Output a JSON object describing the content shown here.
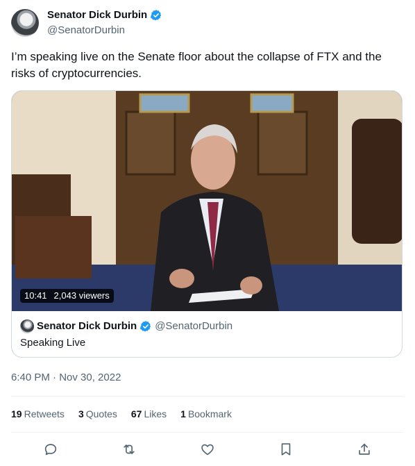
{
  "author": {
    "name": "Senator Dick Durbin",
    "handle": "@SenatorDurbin"
  },
  "tweet": {
    "text": "I’m speaking live on the Senate floor about the collapse of FTX and the risks of cryptocurrencies."
  },
  "video_card": {
    "duration": "10:41",
    "viewers": "2,043 viewers",
    "author_name": "Senator Dick Durbin",
    "author_handle": "@SenatorDurbin",
    "title": "Speaking Live"
  },
  "timestamp": "6:40 PM · Nov 30, 2022",
  "stats": [
    {
      "count": "19",
      "label": "Retweets"
    },
    {
      "count": "3",
      "label": "Quotes"
    },
    {
      "count": "67",
      "label": "Likes"
    },
    {
      "count": "1",
      "label": "Bookmark"
    }
  ],
  "actions": [
    "reply-icon",
    "retweet-icon",
    "like-icon",
    "bookmark-icon",
    "share-icon"
  ],
  "colors": {
    "verified": "#1d9bf0",
    "text": "#0f1419",
    "muted": "#536471",
    "border": "#cfd9de"
  }
}
